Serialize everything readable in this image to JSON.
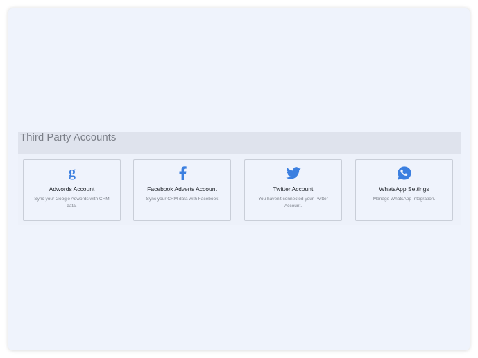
{
  "section": {
    "title": "Third Party Accounts"
  },
  "cards": [
    {
      "icon": "google-g-icon",
      "title": "Adwords Account",
      "description": "Sync your Google Adwords with CRM data."
    },
    {
      "icon": "facebook-f-icon",
      "title": "Facebook Adverts Account",
      "description": "Sync your CRM data with Facebook"
    },
    {
      "icon": "twitter-bird-icon",
      "title": "Twitter Account",
      "description": "You haven't connected your Twitter Account."
    },
    {
      "icon": "whatsapp-icon",
      "title": "WhatsApp Settings",
      "description": "Manage WhatsApp Integration."
    }
  ],
  "colors": {
    "window_bg": "#eff3fc",
    "header_bg": "#dfe3ed",
    "icon_blue": "#3b7fe0"
  }
}
